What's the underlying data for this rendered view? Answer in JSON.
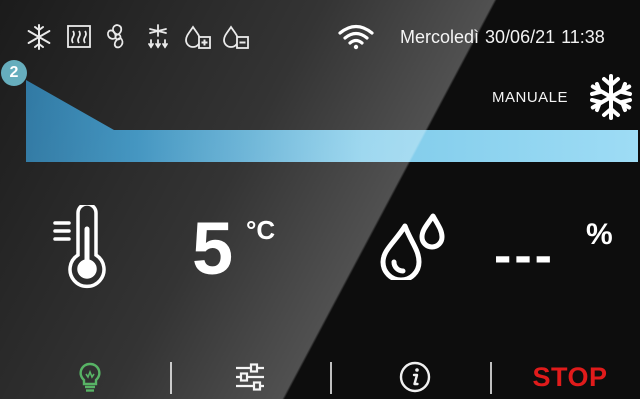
{
  "status_bar": {
    "icons": [
      "snowflake-icon",
      "heater-icon",
      "fan-icon",
      "defrost-icon",
      "humidity-plus-icon",
      "humidity-minus-icon"
    ],
    "wifi_icon": "wifi-icon",
    "day": "Mercoledì",
    "date": "30/06/21",
    "time": "11:38"
  },
  "cycle": {
    "step": "2",
    "mode": "MANUALE",
    "mode_icon": "snowflake-icon",
    "progress_color": "#7fd0f0"
  },
  "readings": {
    "temperature": {
      "value": "5",
      "unit": "°C",
      "icon": "thermometer-icon"
    },
    "humidity": {
      "value": "---",
      "unit": "%",
      "icon": "humidity-drops-icon"
    }
  },
  "toolbar": {
    "light_icon": "bulb-icon",
    "light_color": "#3aa64a",
    "settings_icon": "sliders-icon",
    "info_icon": "info-icon",
    "stop_label": "STOP",
    "stop_color": "#e01b1b"
  }
}
